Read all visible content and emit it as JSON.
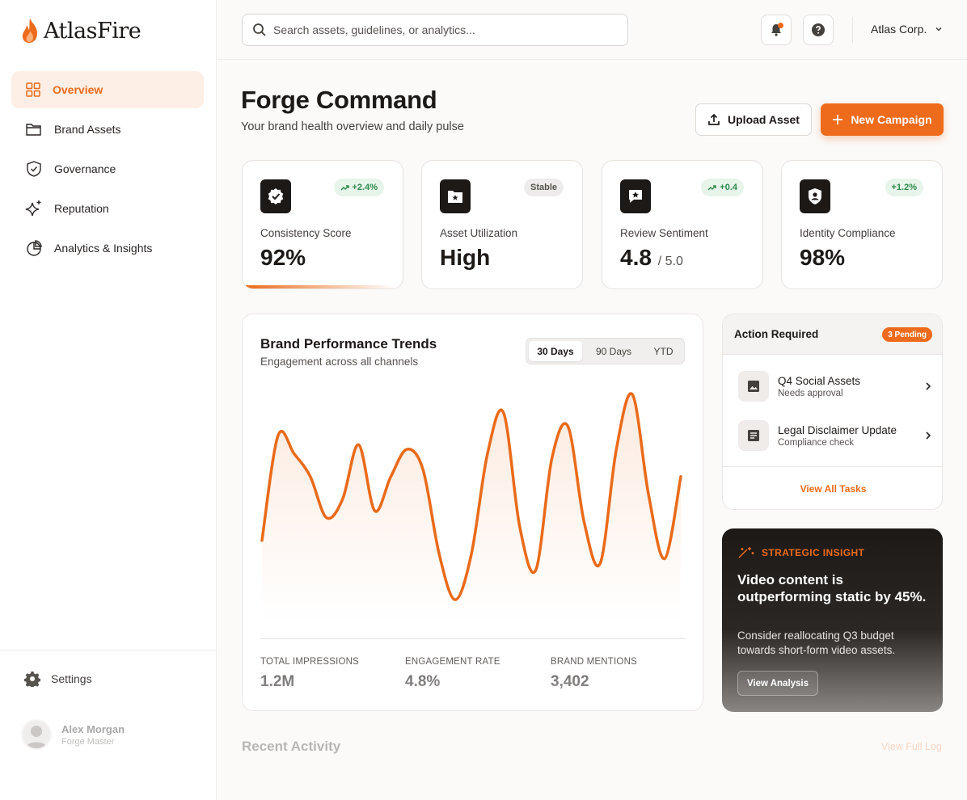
{
  "brand": {
    "name": "AtlasFire"
  },
  "sidebar": {
    "items": [
      {
        "label": "Overview",
        "icon": "grid-icon",
        "active": true
      },
      {
        "label": "Brand Assets",
        "icon": "folder-icon"
      },
      {
        "label": "Governance",
        "icon": "shield-check-icon"
      },
      {
        "label": "Reputation",
        "icon": "sparkles-icon"
      },
      {
        "label": "Analytics & Insights",
        "icon": "pie-chart-icon"
      }
    ],
    "settings_label": "Settings",
    "user": {
      "name": "Alex Morgan",
      "role": "Forge Master"
    }
  },
  "topbar": {
    "search_placeholder": "Search assets, guidelines, or analytics...",
    "org_name": "Atlas Corp."
  },
  "header": {
    "title": "Forge Command",
    "subtitle": "Your brand health overview and daily pulse",
    "upload_label": "Upload Asset",
    "new_campaign_label": "New Campaign"
  },
  "stats": [
    {
      "label": "Consistency Score",
      "value": "92%",
      "badge": "+2.4%",
      "badge_type": "up",
      "icon": "verified-badge-icon"
    },
    {
      "label": "Asset Utilization",
      "value": "High",
      "badge": "Stable",
      "badge_type": "neutral",
      "icon": "folder-star-icon"
    },
    {
      "label": "Review Sentiment",
      "value": "4.8",
      "suffix": "/ 5.0",
      "badge": "+0.4",
      "badge_type": "up",
      "icon": "star-message-icon"
    },
    {
      "label": "Identity Compliance",
      "value": "98%",
      "badge": "+1.2%",
      "badge_type": "up",
      "icon": "shield-person-icon"
    }
  ],
  "trends": {
    "title": "Brand Performance Trends",
    "subtitle": "Engagement across all channels",
    "ranges": [
      "30 Days",
      "90 Days",
      "YTD"
    ],
    "active_range": "30 Days",
    "metrics": [
      {
        "label": "TOTAL IMPRESSIONS",
        "value": "1.2M"
      },
      {
        "label": "ENGAGEMENT RATE",
        "value": "4.8%"
      },
      {
        "label": "BRAND MENTIONS",
        "value": "3,402"
      }
    ],
    "accent_color": "#ea6a1a"
  },
  "chart_data": {
    "type": "area",
    "title": "Brand Performance Trends",
    "x": [
      0,
      1,
      2,
      3,
      4,
      5,
      6,
      7,
      8,
      9,
      10,
      11,
      12,
      13,
      14,
      15,
      16,
      17,
      18,
      19,
      20,
      21,
      22,
      23,
      24,
      25,
      26
    ],
    "values": [
      32,
      78,
      70,
      60,
      42,
      50,
      74,
      45,
      60,
      72,
      63,
      26,
      6,
      26,
      70,
      88,
      38,
      19,
      68,
      82,
      40,
      22,
      72,
      96,
      52,
      24,
      60
    ],
    "ylim": [
      0,
      100
    ],
    "grid": false,
    "legend": "none",
    "color": "#ea6a1a"
  },
  "actions": {
    "title": "Action Required",
    "pending_label": "3 Pending",
    "tasks": [
      {
        "name": "Q4 Social Assets",
        "sub": "Needs approval",
        "icon": "image-icon"
      },
      {
        "name": "Legal Disclaimer Update",
        "sub": "Compliance check",
        "icon": "document-icon"
      }
    ],
    "view_all_label": "View All Tasks"
  },
  "insight": {
    "kicker": "STRATEGIC INSIGHT",
    "headline": "Video content is outperforming static by 45%.",
    "body": "Consider reallocating Q3 budget towards short-form video assets.",
    "button_label": "View Analysis"
  },
  "recent": {
    "title": "Recent Activity",
    "link_label": "View Full Log"
  }
}
